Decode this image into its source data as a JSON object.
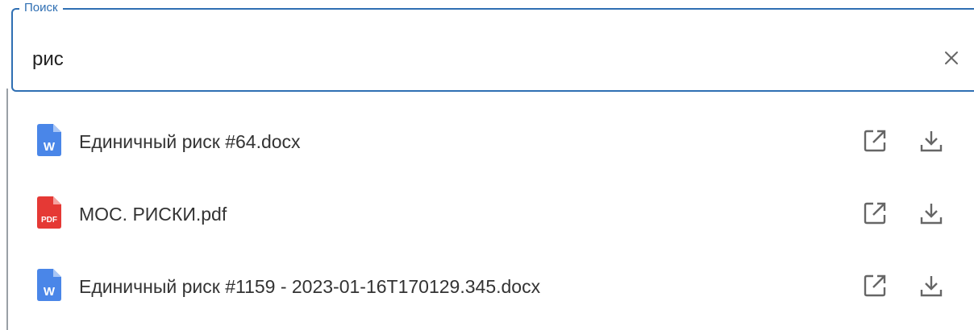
{
  "search": {
    "label": "Поиск",
    "value": "рис",
    "clear_icon": "close-icon"
  },
  "results": [
    {
      "name": "Единичный риск #64.docx",
      "type": "docx",
      "icon": "word-file-icon",
      "icon_label": "W"
    },
    {
      "name": "МОС. РИСКИ.pdf",
      "type": "pdf",
      "icon": "pdf-file-icon",
      "icon_label": "PDF"
    },
    {
      "name": "Единичный риск #1159 - 2023-01-16T170129.345.docx",
      "type": "docx",
      "icon": "word-file-icon",
      "icon_label": "W"
    }
  ],
  "actions": {
    "open_icon": "open-in-new-icon",
    "download_icon": "download-icon"
  },
  "colors": {
    "accent": "#2f6fb3",
    "word": "#4a86e8",
    "pdf": "#e53935",
    "icon_gray": "#666666"
  }
}
